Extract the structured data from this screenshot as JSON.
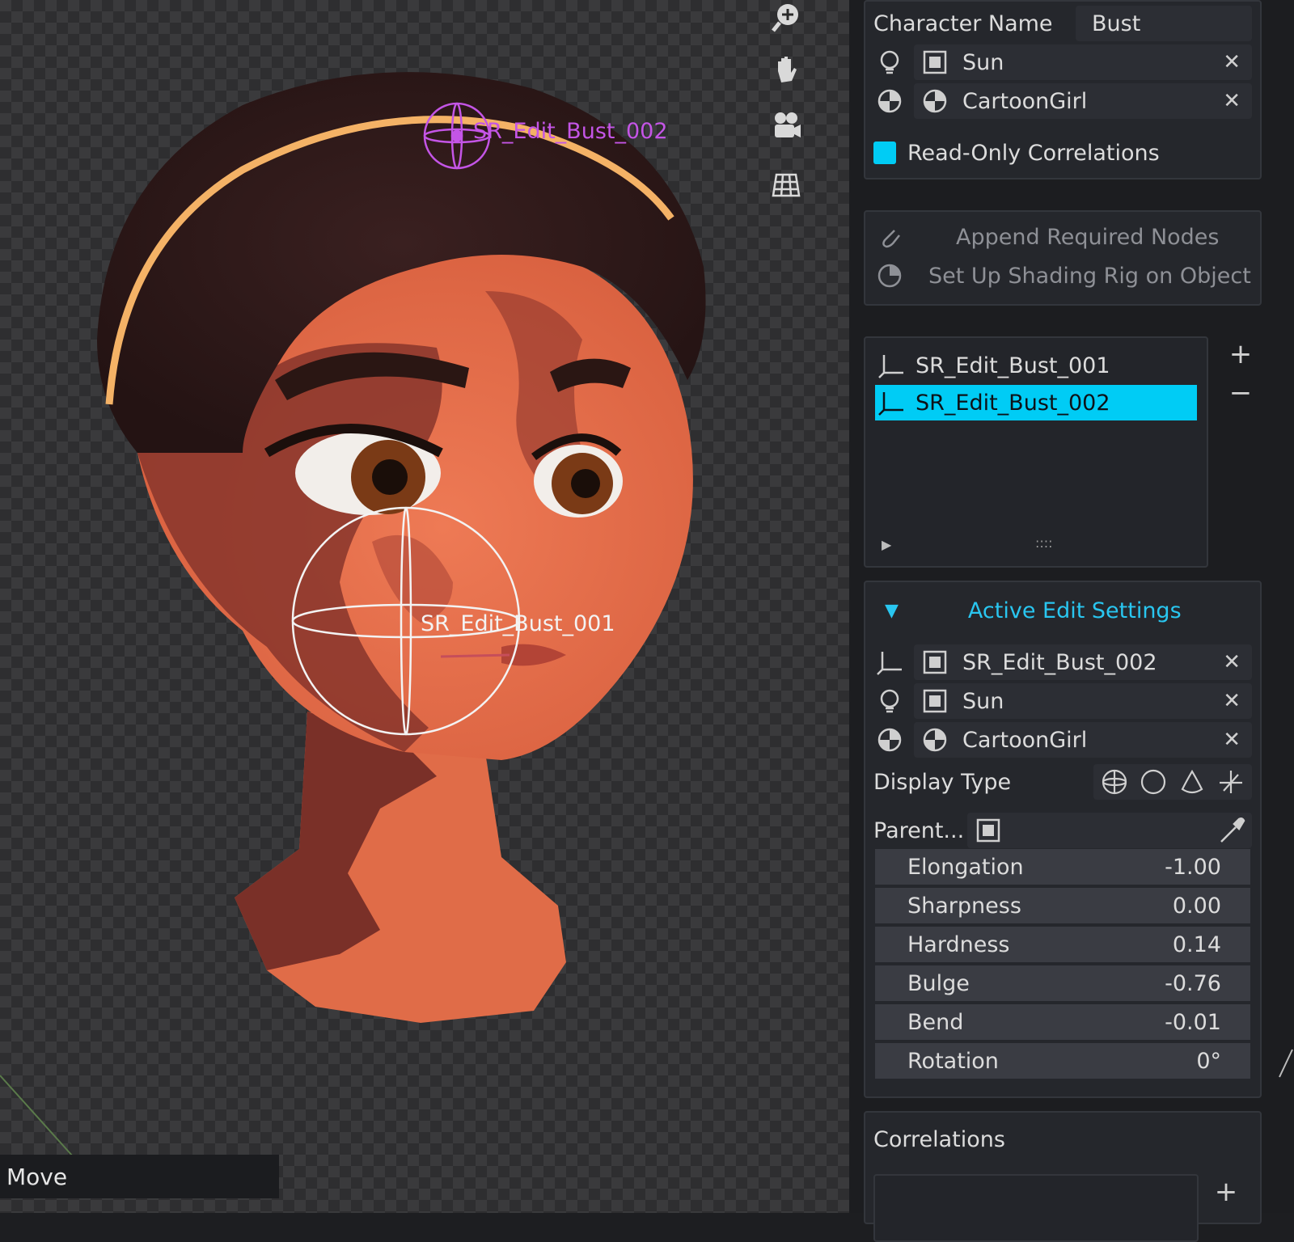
{
  "viewport": {
    "gizmo_labels": [
      "SR_Edit_Bust_002",
      "SR_Edit_Bust_001"
    ],
    "toolbar": [
      "zoom-icon",
      "pan-hand-icon",
      "camera-icon",
      "grid-icon"
    ],
    "status_text": "Move"
  },
  "character": {
    "name_label": "Character Name",
    "name_value": "Bust",
    "light_value": "Sun",
    "material_value": "CartoonGirl",
    "readonly_label": "Read-Only Correlations",
    "readonly_checked": true
  },
  "actions": {
    "append": "Append Required Nodes",
    "setup": "Set Up Shading Rig on Object"
  },
  "edits": {
    "items": [
      "SR_Edit_Bust_001",
      "SR_Edit_Bust_002"
    ],
    "selected": "SR_Edit_Bust_002",
    "add_label": "+",
    "remove_label": "−",
    "grip_label": "::::"
  },
  "active": {
    "title": "Active Edit Settings",
    "edit_value": "SR_Edit_Bust_002",
    "light_value": "Sun",
    "material_value": "CartoonGirl",
    "display_type_label": "Display Type",
    "parent_label": "Parent...",
    "params": [
      {
        "label": "Elongation",
        "value": "-1.00"
      },
      {
        "label": "Sharpness",
        "value": "0.00"
      },
      {
        "label": "Hardness",
        "value": "0.14"
      },
      {
        "label": "Bulge",
        "value": "-0.76"
      },
      {
        "label": "Bend",
        "value": "-0.01"
      },
      {
        "label": "Rotation",
        "value": "0°"
      }
    ]
  },
  "correlations": {
    "title": "Correlations",
    "add_label": "+"
  },
  "colors": {
    "accent": "#00ccf5",
    "gizmo_purple": "#c455e6"
  }
}
